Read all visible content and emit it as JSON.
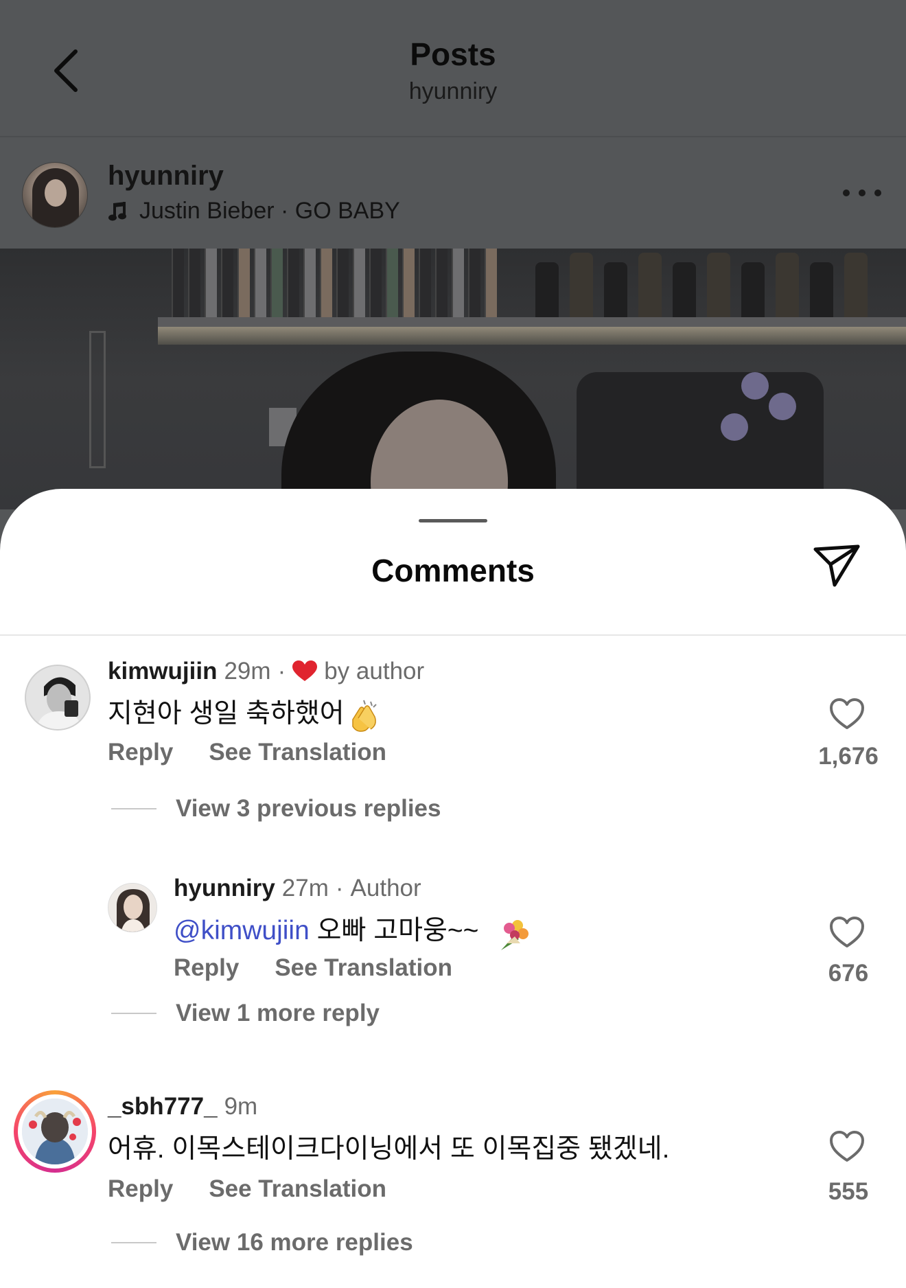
{
  "topbar": {
    "title": "Posts",
    "subtitle": "hyunniry"
  },
  "post": {
    "username": "hyunniry",
    "music": "Justin Bieber · GO BABY"
  },
  "sheet": {
    "title": "Comments"
  },
  "comments": [
    {
      "username": "kimwujiin",
      "time": "29m",
      "separator": "·",
      "badge": "by author",
      "text": "지현아 생일 축하했어",
      "reply_label": "Reply",
      "translate_label": "See Translation",
      "likes": "1,676",
      "view_replies": "View 3 previous replies"
    },
    {
      "username": "hyunniry",
      "time": "27m",
      "separator": "·",
      "badge": "Author",
      "mention": "@kimwujiin",
      "text": " 오빠 고마웅~~",
      "reply_label": "Reply",
      "translate_label": "See Translation",
      "likes": "676",
      "view_replies": "View 1 more reply"
    },
    {
      "username": "_sbh777_",
      "time": "9m",
      "text": "어휴. 이목스테이크다이닝에서 또 이목집중 됐겠네.",
      "reply_label": "Reply",
      "translate_label": "See Translation",
      "likes": "555",
      "view_replies": "View 16 more replies"
    }
  ],
  "colors": {
    "mention": "#3f4fc7",
    "heart": "#e0242f",
    "story_ring_start": "#f9a13a",
    "story_ring_end": "#d42d8f"
  },
  "icons": [
    "back-chevron-icon",
    "music-note-icon",
    "more-icon",
    "share-icon",
    "heart-icon",
    "clapping-hands-emoji",
    "bouquet-emoji"
  ]
}
